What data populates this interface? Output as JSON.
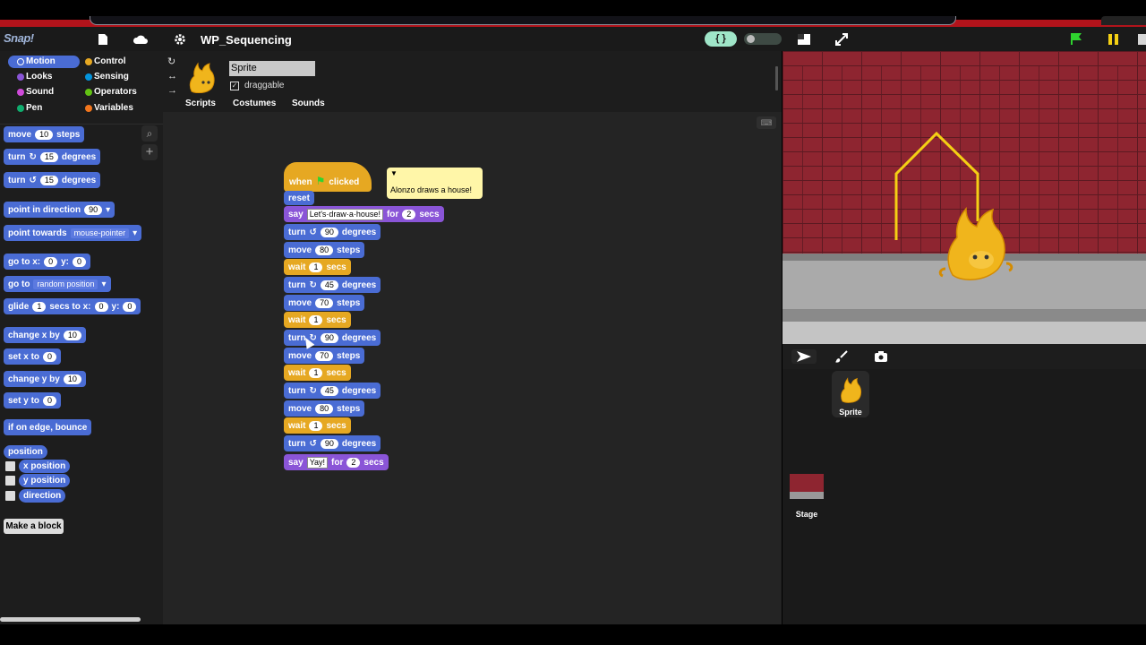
{
  "app": {
    "logo": "Snap!",
    "project_title": "WP_Sequencing",
    "lang_toggle": "{ }"
  },
  "categories": [
    {
      "label": "Motion",
      "color": "#4a6cd4"
    },
    {
      "label": "Looks",
      "color": "#8a55d7"
    },
    {
      "label": "Sound",
      "color": "#cf4ad9"
    },
    {
      "label": "Pen",
      "color": "#0fad6e"
    },
    {
      "label": "Control",
      "color": "#e6a822"
    },
    {
      "label": "Sensing",
      "color": "#0494dc"
    },
    {
      "label": "Operators",
      "color": "#62c213"
    },
    {
      "label": "Variables",
      "color": "#f3761d"
    }
  ],
  "palette": {
    "move": {
      "a": "move",
      "v": "10",
      "b": "steps"
    },
    "turn_cw": {
      "a": "turn",
      "v": "15",
      "b": "degrees"
    },
    "turn_ccw": {
      "a": "turn",
      "v": "15",
      "b": "degrees"
    },
    "point_dir": {
      "a": "point in direction",
      "v": "90"
    },
    "point_towards": {
      "a": "point towards",
      "v": "mouse-pointer"
    },
    "goto_xy": {
      "a": "go to x:",
      "x": "0",
      "b": "y:",
      "y": "0"
    },
    "goto": {
      "a": "go to",
      "v": "random position"
    },
    "glide": {
      "a": "glide",
      "s": "1",
      "b": "secs to x:",
      "x": "0",
      "c": "y:",
      "y": "0"
    },
    "change_x": {
      "a": "change x by",
      "v": "10"
    },
    "set_x": {
      "a": "set x to",
      "v": "0"
    },
    "change_y": {
      "a": "change y by",
      "v": "10"
    },
    "set_y": {
      "a": "set y to",
      "v": "0"
    },
    "bounce": "if on edge, bounce",
    "position": "position",
    "x_position": "x position",
    "y_position": "y position",
    "direction": "direction",
    "make_block": "Make a block"
  },
  "sprite": {
    "name": "Sprite",
    "draggable_label": "draggable",
    "draggable_check": "✓"
  },
  "tabs": [
    "Scripts",
    "Costumes",
    "Sounds"
  ],
  "script": {
    "hat_when": "when",
    "hat_clicked": "clicked",
    "reset": "reset",
    "say_first": {
      "a": "say",
      "text": "Let's·draw·a·house!",
      "b": "for",
      "v": "2",
      "c": "secs"
    },
    "turn1": {
      "a": "turn",
      "v": "90",
      "b": "degrees"
    },
    "move1": {
      "a": "move",
      "v": "80",
      "b": "steps"
    },
    "wait1": {
      "a": "wait",
      "v": "1",
      "b": "secs"
    },
    "turn2": {
      "a": "turn",
      "v": "45",
      "b": "degrees"
    },
    "move2": {
      "a": "move",
      "v": "70",
      "b": "steps"
    },
    "wait2": {
      "a": "wait",
      "v": "1",
      "b": "secs"
    },
    "turn3": {
      "a": "turn",
      "v": "90",
      "b": "degrees"
    },
    "move3": {
      "a": "move",
      "v": "70",
      "b": "steps"
    },
    "wait3": {
      "a": "wait",
      "v": "1",
      "b": "secs"
    },
    "turn4": {
      "a": "turn",
      "v": "45",
      "b": "degrees"
    },
    "move4": {
      "a": "move",
      "v": "80",
      "b": "steps"
    },
    "wait4": {
      "a": "wait",
      "v": "1",
      "b": "secs"
    },
    "turn5": {
      "a": "turn",
      "v": "90",
      "b": "degrees"
    },
    "say_last": {
      "a": "say",
      "text": "Yay!",
      "b": "for",
      "v": "2",
      "c": "secs"
    }
  },
  "comment": {
    "text": "Alonzo draws a house!"
  },
  "corral": {
    "sprite_label": "Sprite",
    "stage_label": "Stage"
  },
  "colors": {
    "motion": "#4a6cd4",
    "control": "#e6a822",
    "looks": "#8a55d7",
    "house_line": "#f4d014"
  }
}
